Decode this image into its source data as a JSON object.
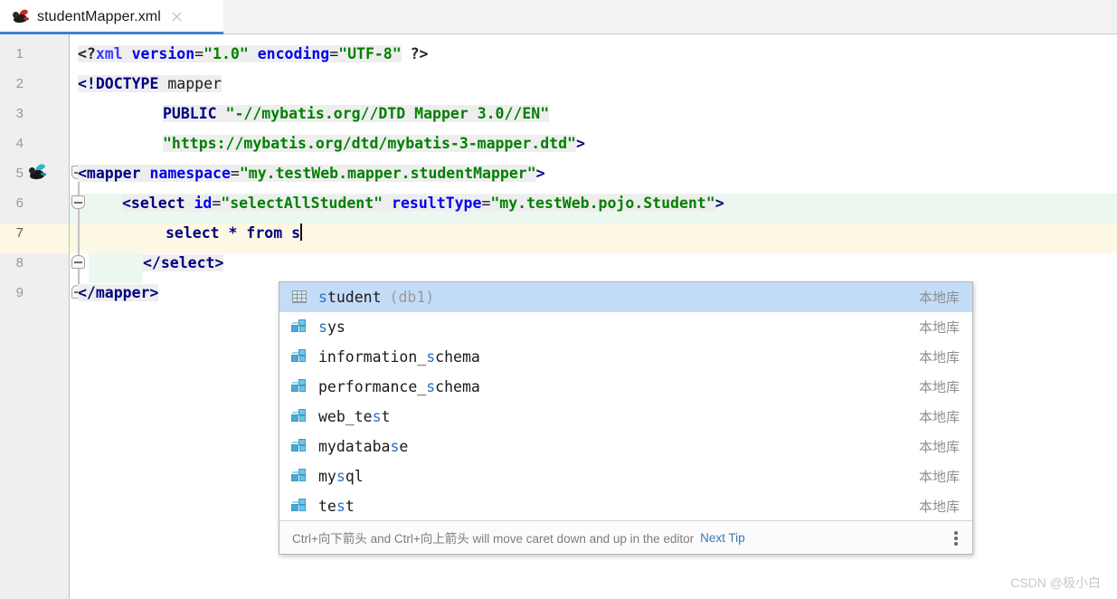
{
  "window": {
    "accent_color": "#4083c9",
    "background": "#ffffff"
  },
  "tab": {
    "title": "studentMapper.xml",
    "icon": "mybatis-bird-icon",
    "close_label": "×"
  },
  "editor": {
    "gutter_icon_line": 5,
    "current_line": 7,
    "lines": [
      {
        "num": "1",
        "highlight": "none"
      },
      {
        "num": "2",
        "highlight": "none"
      },
      {
        "num": "3",
        "highlight": "none"
      },
      {
        "num": "4",
        "highlight": "none"
      },
      {
        "num": "5",
        "highlight": "none"
      },
      {
        "num": "6",
        "highlight": "green"
      },
      {
        "num": "7",
        "highlight": "yellow"
      },
      {
        "num": "8",
        "highlight": "green"
      },
      {
        "num": "9",
        "highlight": "none"
      }
    ],
    "code": {
      "l1_open": "<?",
      "l1_xml": "xml",
      "l1_sp1": " ",
      "l1_attr_version": "version",
      "l1_eq1": "=",
      "l1_val_version": "\"1.0\"",
      "l1_sp2": " ",
      "l1_attr_encoding": "encoding",
      "l1_eq2": "=",
      "l1_val_encoding": "\"UTF-8\"",
      "l1_close": " ?>",
      "l2_doctype": "<!DOCTYPE",
      "l2_name": " mapper",
      "l3_public": "PUBLIC",
      "l3_str": " \"-//mybatis.org//DTD Mapper 3.0//EN\"",
      "l4_str": "\"https://mybatis.org/dtd/mybatis-3-mapper.dtd\"",
      "l4_gt": ">",
      "l5_tag": "<mapper ",
      "l5_attr": "namespace",
      "l5_eq": "=",
      "l5_val": "\"my.testWeb.mapper.studentMapper\"",
      "l5_gt": ">",
      "l6_tag": "<select ",
      "l6_attr1": "id",
      "l6_eq1": "=",
      "l6_val1": "\"selectAllStudent\"",
      "l6_sp": " ",
      "l6_attr2": "resultType",
      "l6_eq2": "=",
      "l6_val2": "\"my.testWeb.pojo.Student\"",
      "l6_gt": ">",
      "l7_sql": "select * from s",
      "l8_close": "</select>",
      "l9_close": "</mapper>"
    }
  },
  "completion_popup": {
    "items": [
      {
        "label": "student",
        "match_prefix": "s",
        "sub": "(db1)",
        "right": "本地库",
        "icon": "table-icon",
        "selected": true
      },
      {
        "label": "sys",
        "match_prefix": "s",
        "sub": "",
        "right": "本地库",
        "icon": "schema-icon",
        "selected": false
      },
      {
        "label": "information_schema",
        "match_prefix": "",
        "sub": "",
        "right": "本地库",
        "icon": "schema-icon",
        "selected": false
      },
      {
        "label": "performance_schema",
        "match_prefix": "",
        "sub": "",
        "right": "本地库",
        "icon": "schema-icon",
        "selected": false
      },
      {
        "label": "web_test",
        "match_prefix": "",
        "sub": "",
        "right": "本地库",
        "icon": "schema-icon",
        "selected": false
      },
      {
        "label": "mydatabase",
        "match_prefix": "",
        "sub": "",
        "right": "本地库",
        "icon": "schema-icon",
        "selected": false
      },
      {
        "label": "mysql",
        "match_prefix": "",
        "sub": "",
        "right": "本地库",
        "icon": "schema-icon",
        "selected": false
      },
      {
        "label": "test",
        "match_prefix": "",
        "sub": "",
        "right": "本地库",
        "icon": "schema-icon",
        "selected": false
      }
    ],
    "footer_tip": "Ctrl+向下箭头 and Ctrl+向上箭头 will move caret down and up in the editor",
    "footer_link": "Next Tip",
    "selected_color": "#c3dcf7"
  },
  "watermark": {
    "text": "CSDN @极小白"
  }
}
